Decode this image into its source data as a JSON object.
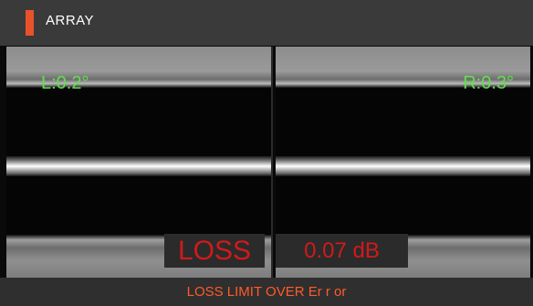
{
  "header": {
    "title": "ARRAY",
    "accent_color": "#e8522a"
  },
  "left_view": {
    "angle": "L:0.2°"
  },
  "right_view": {
    "angle": "R:0.3°"
  },
  "loss": {
    "label": "LOSS",
    "value": "0.07 dB",
    "color": "#d11a1a"
  },
  "status": {
    "error_text": "LOSS LIMIT OVER Er r or"
  }
}
